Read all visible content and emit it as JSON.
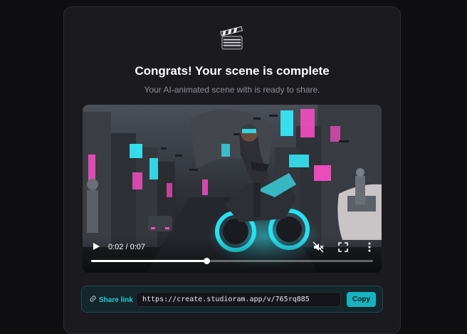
{
  "header": {
    "title": "Congrats! Your scene is complete",
    "subtitle": "Your AI-animated scene with is ready to share."
  },
  "video": {
    "current_time": "0:02",
    "duration": "0:07",
    "time_display": "0:02 / 0:07",
    "progress": 0.41,
    "muted": true,
    "icons": [
      "play-icon",
      "muted-speaker-icon",
      "fullscreen-icon",
      "more-vertical-icon"
    ]
  },
  "share": {
    "label": "Share link",
    "url": "https://create.studioram.app/v/765rq885",
    "copy_label": "Copy"
  },
  "colors": {
    "accent": "#17b3bf",
    "accent_text": "#2ec9d6",
    "card_bg": "#1a1a1f",
    "page_bg": "#0f0f12"
  }
}
